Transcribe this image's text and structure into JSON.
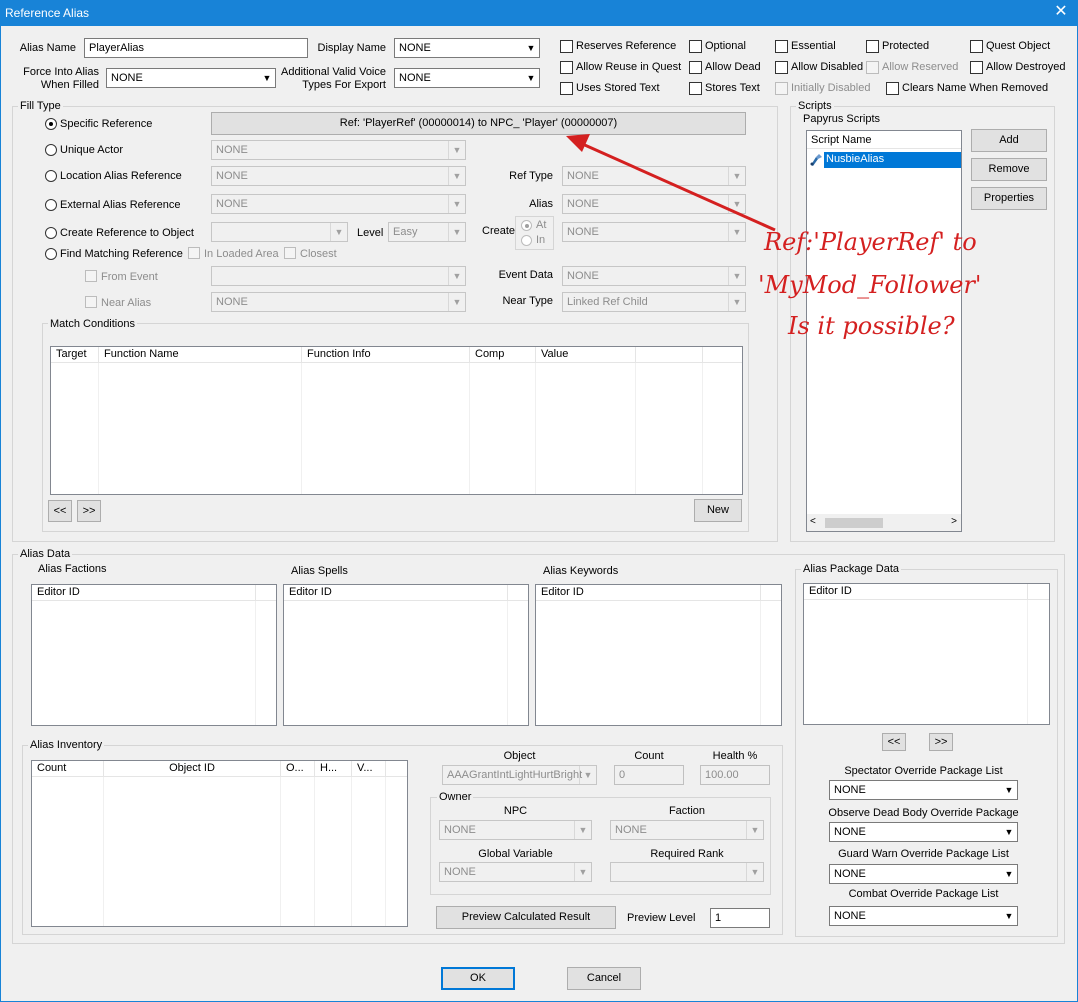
{
  "window": {
    "title": "Reference Alias",
    "close": "✕"
  },
  "top": {
    "alias_name_label": "Alias Name",
    "alias_name_value": "PlayerAlias",
    "display_name_label": "Display Name",
    "display_name_value": "NONE",
    "force_label_1": "Force Into Alias",
    "force_label_2": "When Filled",
    "force_value": "NONE",
    "voice_label_1": "Additional Valid Voice",
    "voice_label_2": "Types For Export",
    "voice_value": "NONE"
  },
  "flags": [
    "Reserves Reference",
    "Optional",
    "Essential",
    "Protected",
    "Quest Object",
    "Allow Reuse in Quest",
    "Allow Dead",
    "Allow Disabled",
    "Allow Reserved",
    "Allow Destroyed",
    "Uses Stored Text",
    "Stores Text",
    "Initially Disabled",
    "Clears Name When Removed"
  ],
  "fill": {
    "group": "Fill Type",
    "specific": "Specific Reference",
    "ref_button": "Ref: 'PlayerRef' (00000014) to NPC_ 'Player' (00000007)",
    "unique": "Unique Actor",
    "unique_value": "NONE",
    "location": "Location Alias Reference",
    "location_value": "NONE",
    "external": "External Alias Reference",
    "external_value": "NONE",
    "create": "Create Reference to Object",
    "create_value": "",
    "level_label": "Level",
    "level_value": "Easy",
    "create_label": "Create",
    "at": "At",
    "in": "In",
    "create_alias_value": "NONE",
    "find": "Find Matching Reference",
    "in_loaded": "In Loaded Area",
    "closest": "Closest",
    "from_event": "From Event",
    "from_event_value": "",
    "near_alias": "Near Alias",
    "near_alias_value": "NONE",
    "ref_type_label": "Ref Type",
    "ref_type_value": "NONE",
    "alias_label": "Alias",
    "alias_value": "NONE",
    "event_data_label": "Event Data",
    "event_data_value": "NONE",
    "near_type_label": "Near Type",
    "near_type_value": "Linked Ref Child"
  },
  "match": {
    "group": "Match Conditions",
    "columns": [
      "Target",
      "Function Name",
      "Function Info",
      "Comp",
      "Value"
    ],
    "prev": "<<",
    "next": ">>",
    "new": "New"
  },
  "scripts": {
    "group": "Scripts",
    "papyrus": "Papyrus Scripts",
    "column": "Script Name",
    "item": "NusbieAlias",
    "add": "Add",
    "remove": "Remove",
    "properties": "Properties"
  },
  "annotation": {
    "line1": "Ref:'PlayerRef' to",
    "line2": "'MyMod_Follower'",
    "line3": "Is it possible?",
    "color": "#d42020"
  },
  "alias_data": {
    "group": "Alias Data",
    "factions": "Alias Factions",
    "spells": "Alias Spells",
    "keywords": "Alias Keywords",
    "editor_id": "Editor ID",
    "package_group": "Alias Package Data",
    "prev": "<<",
    "next": ">>",
    "spectator": "Spectator Override Package List",
    "spectator_value": "NONE",
    "observe": "Observe Dead Body Override Package",
    "observe_value": "NONE",
    "guard": "Guard Warn Override Package List",
    "guard_value": "NONE",
    "combat": "Combat Override Package List",
    "combat_value": "NONE"
  },
  "inventory": {
    "group": "Alias Inventory",
    "columns": [
      "Count",
      "Object ID",
      "O...",
      "H...",
      "V..."
    ],
    "object_label": "Object",
    "object_value": "AAAGrantIntLightHurtBright",
    "count_label": "Count",
    "count_value": "0",
    "health_label": "Health %",
    "health_value": "100.00",
    "owner_group": "Owner",
    "npc_label": "NPC",
    "npc_value": "NONE",
    "faction_label": "Faction",
    "faction_value": "NONE",
    "global_label": "Global Variable",
    "global_value": "NONE",
    "rank_label": "Required Rank",
    "rank_value": "",
    "preview_button": "Preview Calculated Result",
    "preview_level_label": "Preview Level",
    "preview_level_value": "1"
  },
  "footer": {
    "ok": "OK",
    "cancel": "Cancel"
  },
  "colors": {
    "title_bar": "#1883d7",
    "selection": "#0078d7"
  }
}
